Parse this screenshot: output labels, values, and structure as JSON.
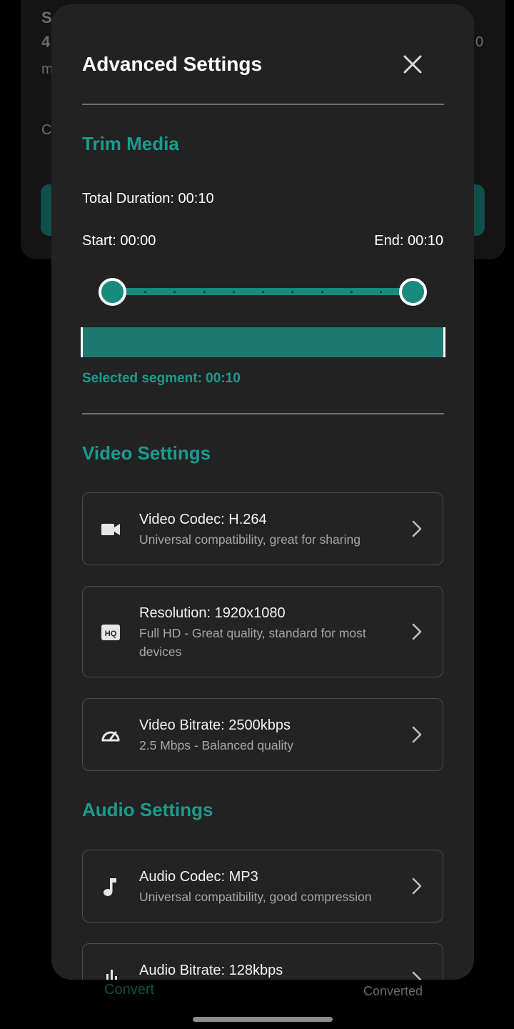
{
  "background": {
    "card_letters": [
      "S",
      "4",
      "m",
      "C"
    ],
    "card_right_char": "0",
    "nav": {
      "convert": "Convert",
      "converted": "Converted"
    }
  },
  "modal": {
    "title": "Advanced Settings",
    "trim": {
      "heading": "Trim Media",
      "total_duration": "Total Duration: 00:10",
      "start": "Start: 00:00",
      "end": "End: 00:10",
      "selected_segment": "Selected segment: 00:10",
      "range": {
        "start_fraction": 0,
        "end_fraction": 1
      }
    },
    "video": {
      "heading": "Video Settings",
      "items": [
        {
          "icon": "videocam-icon",
          "title": "Video Codec: H.264",
          "subtitle": "Universal compatibility, great for sharing"
        },
        {
          "icon": "hq-icon",
          "title": "Resolution: 1920x1080",
          "subtitle": "Full HD - Great quality, standard for most devices"
        },
        {
          "icon": "speed-icon",
          "title": "Video Bitrate: 2500kbps",
          "subtitle": "2.5 Mbps - Balanced quality"
        }
      ]
    },
    "audio": {
      "heading": "Audio Settings",
      "items": [
        {
          "icon": "music-note-icon",
          "title": "Audio Codec: MP3",
          "subtitle": "Universal compatibility, good compression"
        },
        {
          "icon": "equalizer-icon",
          "title": "Audio Bitrate: 128kbps",
          "subtitle": ""
        }
      ]
    }
  },
  "colors": {
    "accent": "#1a9b8d",
    "surface": "#222222",
    "background": "#000000"
  }
}
